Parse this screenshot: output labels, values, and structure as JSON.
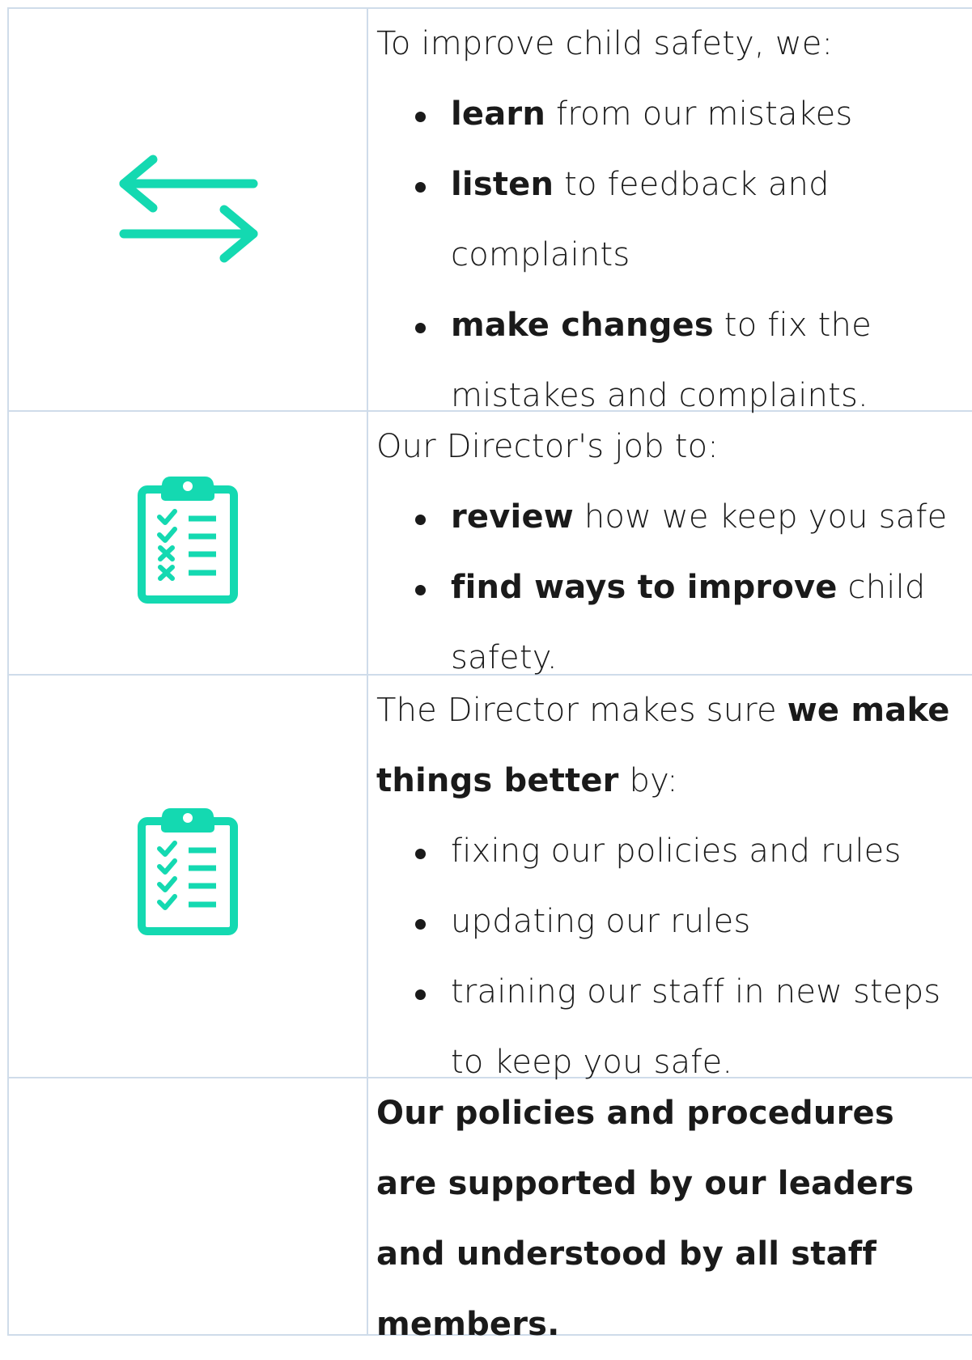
{
  "colors": {
    "icon": "#14d9b1",
    "border": "#cfdcea",
    "text": "#1a1a1a"
  },
  "rows": [
    {
      "icon": "swap-arrows-icon",
      "intro": "To improve child safety, we:",
      "items": [
        {
          "bold": "learn",
          "rest": " from our mistakes"
        },
        {
          "bold": "listen",
          "rest": " to feedback and complaints"
        },
        {
          "bold": "make changes",
          "rest": " to fix the mistakes and complaints."
        }
      ]
    },
    {
      "icon": "checklist-clipboard-icon",
      "intro": "Our Director's job to:",
      "items": [
        {
          "bold": "review",
          "rest": " how we keep you safe"
        },
        {
          "bold": "find ways to improve",
          "rest": " child safety."
        }
      ]
    },
    {
      "icon": "checklist-clipboard-icon",
      "intro_pre": "The Director makes sure ",
      "intro_bold": "we make things better",
      "intro_post": " by:",
      "items": [
        {
          "text": "fixing our policies and rules"
        },
        {
          "text": "updating our rules"
        },
        {
          "text": "training our staff in new steps to keep you safe."
        }
      ]
    },
    {
      "statement": "Our policies and procedures are supported by our leaders and understood by all staff members."
    }
  ]
}
